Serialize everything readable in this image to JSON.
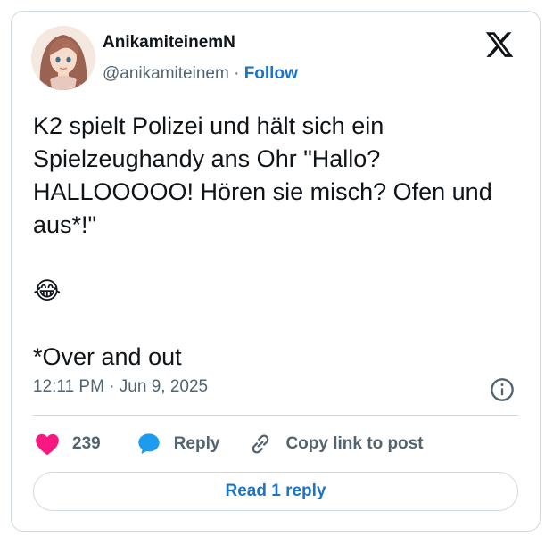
{
  "author": {
    "display_name": "AnikamiteinemN",
    "handle": "@anikamiteinem",
    "separator": "·",
    "follow_label": "Follow"
  },
  "tweet": {
    "text": "K2 spielt Polizei und hält sich ein Spielzeughandy ans Ohr \"Hallo? HALLOOOOO! Hören sie misch? Ofen und aus*!\"\n\n😂\n\n*Over and out",
    "timestamp": "12:11 PM · Jun 9, 2025"
  },
  "actions": {
    "like_count": "239",
    "reply_label": "Reply",
    "copy_link_label": "Copy link to post"
  },
  "read_replies_label": "Read 1 reply",
  "colors": {
    "like": "#f91880",
    "reply": "#1d9bf0",
    "link": "#1d74c7",
    "muted": "#536471",
    "border": "#cfd9de"
  },
  "icons": [
    "x-logo-icon",
    "info-icon",
    "heart-icon",
    "speech-bubble-icon",
    "link-icon"
  ]
}
